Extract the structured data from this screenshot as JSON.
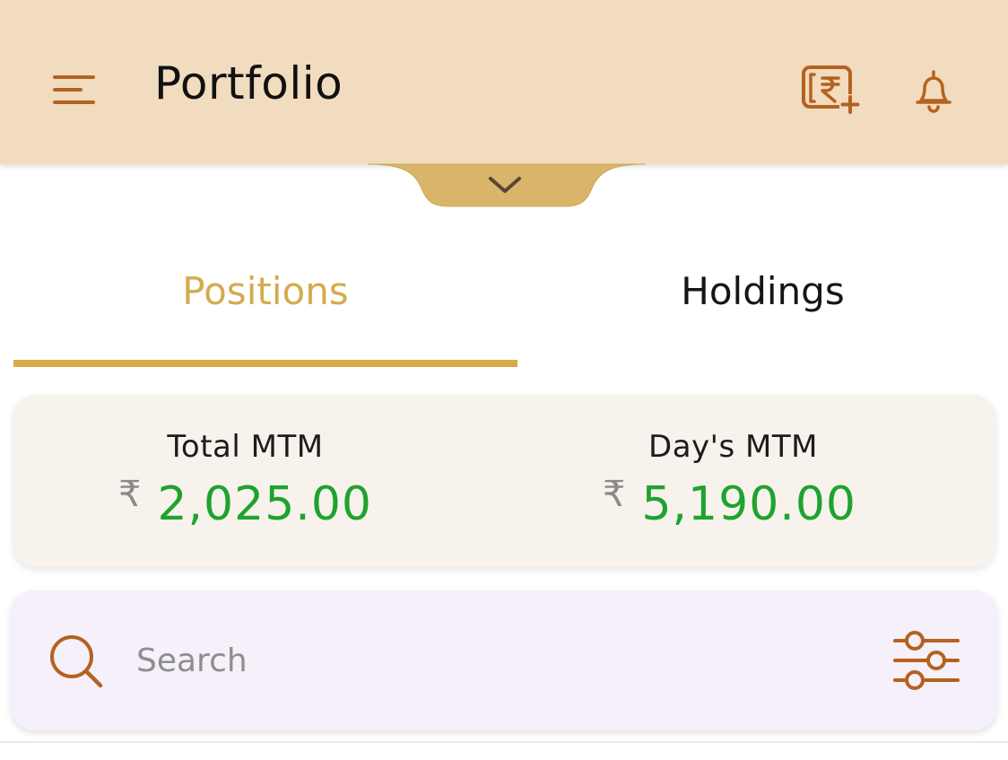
{
  "header": {
    "title": "Portfolio",
    "menu_icon": "hamburger-menu-icon",
    "add_funds_icon": "add-funds-rupee-icon",
    "notification_icon": "bell-icon",
    "background_color": "#f2dcbf",
    "icon_color": "#b5621f"
  },
  "collapse_toggle": {
    "icon": "chevron-down-icon",
    "color": "#d8b56a"
  },
  "tabs": [
    {
      "label": "Positions",
      "active": true
    },
    {
      "label": "Holdings",
      "active": false
    }
  ],
  "accent_color": "#d8aa48",
  "mtm": {
    "total": {
      "label": "Total MTM",
      "currency": "₹",
      "value": "2,025.00"
    },
    "day": {
      "label": "Day's MTM",
      "currency": "₹",
      "value": "5,190.00"
    },
    "positive_color": "#1ea32e"
  },
  "search": {
    "placeholder": "Search",
    "icon": "search-icon",
    "filter_icon": "filter-sliders-icon"
  }
}
